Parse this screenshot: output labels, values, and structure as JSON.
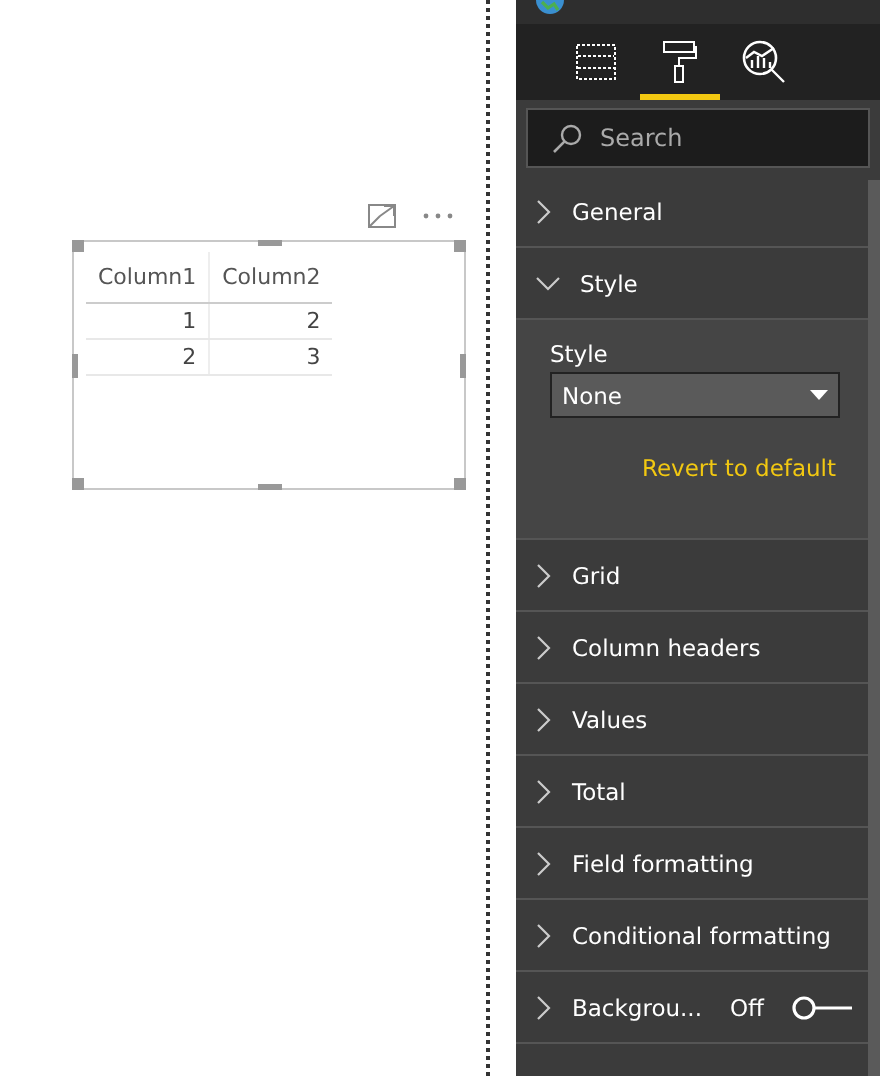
{
  "table": {
    "columns": [
      "Column1",
      "Column2"
    ],
    "rows": [
      [
        "1",
        "2"
      ],
      [
        "2",
        "3"
      ]
    ]
  },
  "panel_tabs": [
    {
      "kind": "fields",
      "selected": false
    },
    {
      "kind": "format",
      "selected": true
    },
    {
      "kind": "analytics",
      "selected": false
    }
  ],
  "search": {
    "placeholder": "Search"
  },
  "sections": [
    {
      "label": "General",
      "expanded": false
    },
    {
      "label": "Style",
      "expanded": true,
      "field_label": "Style",
      "dropdown_value": "None",
      "revert_link": "Revert to default"
    },
    {
      "label": "Grid",
      "expanded": false
    },
    {
      "label": "Column headers",
      "expanded": false
    },
    {
      "label": "Values",
      "expanded": false
    },
    {
      "label": "Total",
      "expanded": false
    },
    {
      "label": "Field formatting",
      "expanded": false
    },
    {
      "label": "Conditional formatting",
      "expanded": false
    },
    {
      "label": "Backgrou...",
      "expanded": false,
      "toggle": {
        "text": "Off",
        "on": false
      }
    }
  ]
}
